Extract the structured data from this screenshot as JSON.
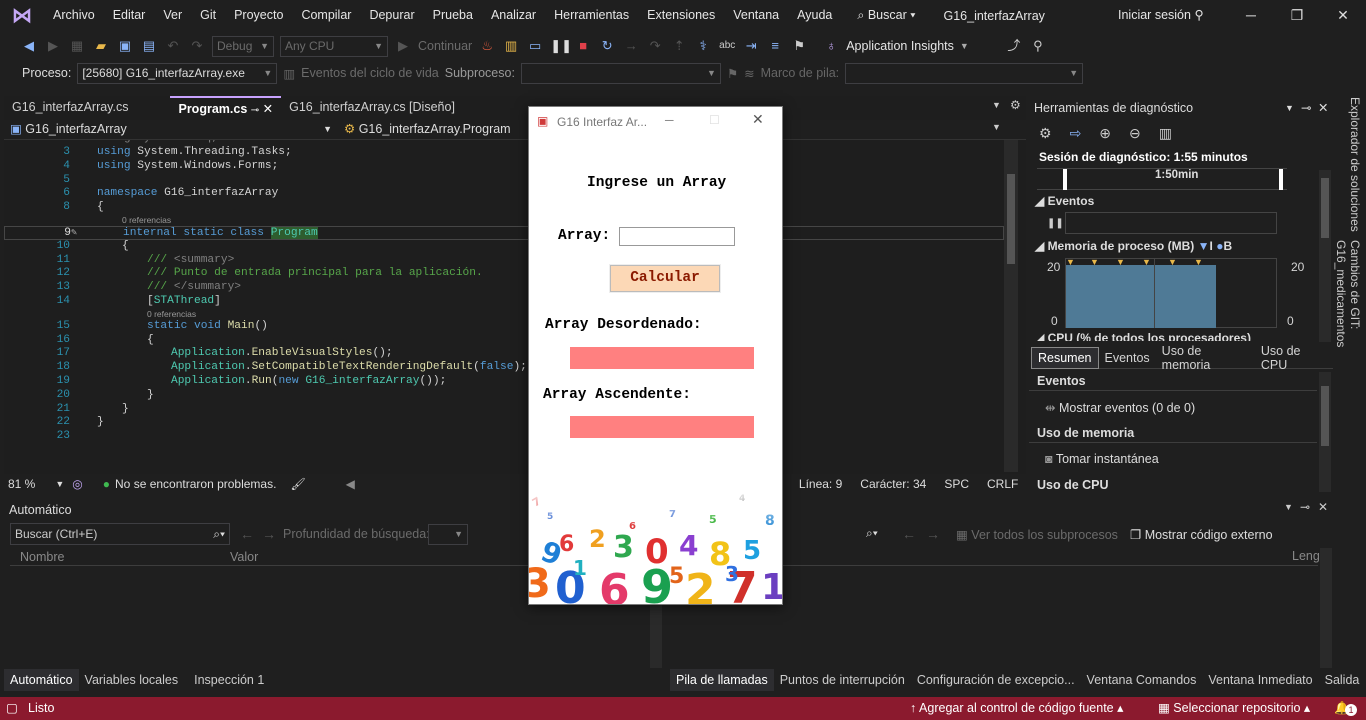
{
  "menubar": {
    "items": [
      "Archivo",
      "Editar",
      "Ver",
      "Git",
      "Proyecto",
      "Compilar",
      "Depurar",
      "Prueba",
      "Analizar",
      "Herramientas",
      "Extensiones",
      "Ventana",
      "Ayuda"
    ],
    "search_label": "Buscar",
    "solution_title": "G16_interfazArray",
    "sign_in": "Iniciar sesión"
  },
  "toolbar": {
    "config": "Debug",
    "platform": "Any CPU",
    "continue_label": "Continuar",
    "app_insights": "Application Insights"
  },
  "toolbar2": {
    "process_label": "Proceso:",
    "process_value": "[25680] G16_interfazArray.exe",
    "lifecycle_label": "Eventos del ciclo de vida",
    "subprocess_label": "Subproceso:",
    "stack_frame_label": "Marco de pila:"
  },
  "editor": {
    "tabs": [
      {
        "label": "G16_interfazArray.cs",
        "active": false
      },
      {
        "label": "Program.cs",
        "active": true
      },
      {
        "label": "G16_interfazArray.cs [Diseño]",
        "active": false
      }
    ],
    "nav_project": "G16_interfazArray",
    "nav_class": "G16_interfazArray.Program",
    "ref_label": "0 referencias",
    "status": {
      "zoom": "81 %",
      "issues": "No se encontraron problemas.",
      "line": "Línea: 9",
      "char": "Carácter: 34",
      "spc": "SPC",
      "crlf": "CRLF"
    }
  },
  "diagnostics": {
    "title": "Herramientas de diagnóstico",
    "session": "Sesión de diagnóstico: 1:55 minutos",
    "timeline_label": "1:50min",
    "events_header": "Eventos",
    "memory_header": "Memoria de proceso (MB)",
    "memory_legend_i": "I",
    "memory_legend_b": "B",
    "mem_max": "20",
    "mem_min": "0",
    "cpu_header": "CPU (% de todos los procesadores)",
    "tabs": [
      "Resumen",
      "Eventos",
      "Uso de memoria",
      "Uso de CPU"
    ],
    "summary_events": "Eventos",
    "show_events": "Mostrar eventos (0 de 0)",
    "memory_usage": "Uso de memoria",
    "take_snapshot": "Tomar instantánea",
    "cpu_usage": "Uso de CPU"
  },
  "side_panels": [
    "Explorador de soluciones",
    "Cambios de GIT: G16_medicamentos"
  ],
  "autos": {
    "title": "Automático",
    "search_placeholder": "Buscar (Ctrl+E)",
    "depth_label": "Profundidad de búsqueda:",
    "columns": [
      "Nombre",
      "Valor"
    ],
    "tabs": [
      "Automático",
      "Variables locales",
      "Inspección 1"
    ]
  },
  "callstack": {
    "all_threads": "Ver todos los subprocesos",
    "show_external": "Mostrar código externo",
    "lang_col": "Leng",
    "tabs": [
      "Pila de llamadas",
      "Puntos de interrupción",
      "Configuración de excepcio...",
      "Ventana Comandos",
      "Ventana Inmediato",
      "Salida"
    ]
  },
  "statusbar": {
    "ready": "Listo",
    "add_source": "Agregar al control de código fuente",
    "select_repo": "Seleccionar repositorio",
    "notif_count": "1"
  },
  "dialog": {
    "title": "G16 Interfaz Ar...",
    "heading": "Ingrese un Array",
    "array_label": "Array:",
    "array_value": "",
    "calc_button": "Calcular",
    "unsorted_label": "Array Desordenado:",
    "sorted_label": "Array Ascendente:"
  },
  "colors": {
    "accent": "#c8a2ff",
    "statusbar": "#8b1a2e",
    "output_box": "#ff8080",
    "calc_button": "#fcd8b6",
    "memory_fill": "#4f7a96"
  }
}
